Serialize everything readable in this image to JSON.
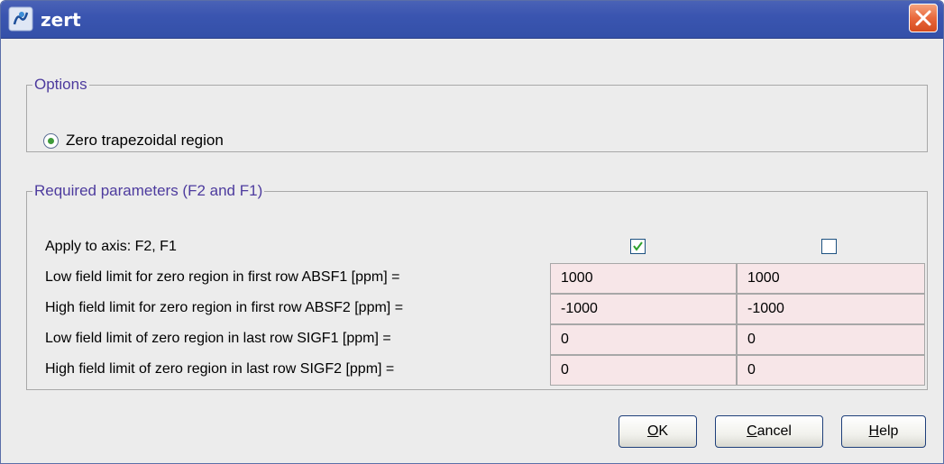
{
  "window": {
    "title": "zert",
    "app_icon": "bruker-app-icon",
    "close_icon": "close-icon"
  },
  "options": {
    "legend": "Options",
    "radio_label": "Zero trapezoidal region",
    "radio_selected": true
  },
  "required": {
    "legend": "Required parameters (F2 and F1)",
    "apply_label": "Apply to axis: F2, F1",
    "apply_f2": true,
    "apply_f1": false,
    "rows": [
      {
        "label": "Low field limit for zero region in first row ABSF1 [ppm] =",
        "f2": "1000",
        "f1": "1000"
      },
      {
        "label": "High field limit for zero region in first row ABSF2 [ppm] =",
        "f2": "-1000",
        "f1": "-1000"
      },
      {
        "label": "Low field limit of zero region in last row SIGF1 [ppm] =",
        "f2": "0",
        "f1": "0"
      },
      {
        "label": "High field limit of zero region in last row SIGF2 [ppm] =",
        "f2": "0",
        "f1": "0"
      }
    ]
  },
  "buttons": {
    "ok": {
      "mnemonic": "O",
      "rest": "K"
    },
    "cancel": {
      "mnemonic": "C",
      "rest": "ancel"
    },
    "help": {
      "mnemonic": "H",
      "rest": "elp"
    }
  },
  "colors": {
    "titlebar": "#3a55b0",
    "legend": "#4d3b9e",
    "field_bg": "#f7e6e8",
    "close": "#e9683c"
  }
}
